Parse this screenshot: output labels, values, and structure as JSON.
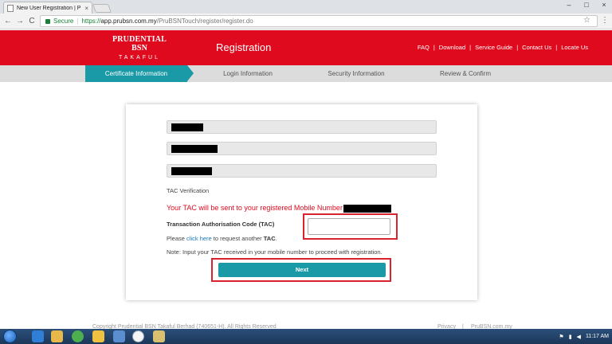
{
  "browser": {
    "tab_title": "New User Registration | P",
    "tab_close": "×",
    "window_controls": [
      "–",
      "□",
      "×"
    ],
    "url_secure_label": "Secure",
    "url_separator": "|",
    "url_scheme": "https://",
    "url_host": "app.prubsn.com.my",
    "url_path": "/PruBSNTouch/register/register.do",
    "nav_back": "←",
    "nav_forward": "→",
    "nav_reload": "C",
    "star": "☆",
    "menu": "⋮"
  },
  "header": {
    "logo_main": "PRUDENTIAL BSN",
    "logo_sub": "TAKAFUL",
    "title": "Registration",
    "links": [
      "FAQ",
      "Download",
      "Service Guide",
      "Contact Us",
      "Locate Us"
    ],
    "divider": "|"
  },
  "steps": [
    "Certificate Information",
    "Login Information",
    "Security Information",
    "Review & Confirm"
  ],
  "form": {
    "tac_section_label": "TAC Verification",
    "tac_message": "Your TAC will be sent to your registered Mobile Number",
    "tac_code_label": "Transaction Authorisation Code (TAC)",
    "tac_input_value": "",
    "request_prefix": "Please ",
    "request_link": "click here",
    "request_middle": " to request another ",
    "request_bold": "TAC",
    "request_suffix": ".",
    "note": "Note: Input your TAC received in your mobile number to proceed with registration.",
    "next_label": "Next"
  },
  "footer": {
    "copyright": "Copyright Prudential BSN Takaful Berhad (740651-H). All Rights Reserved",
    "privacy": "Privacy",
    "divider": "|",
    "site": "PruBSN.com.my"
  },
  "taskbar": {
    "time": "11:17 AM"
  },
  "colors": {
    "brand_red": "#e00a1e",
    "teal": "#1a9aa6",
    "highlight_red": "#d9232e"
  }
}
